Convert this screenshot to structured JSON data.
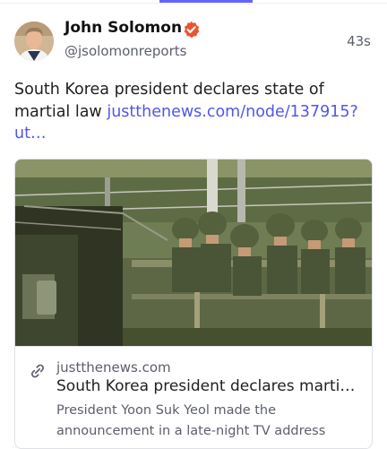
{
  "post": {
    "author_name": "John Solomon",
    "author_handle": "@jsolomonreports",
    "timestamp": "43s",
    "text": "South Korea president declares state of martial law",
    "link_text": "justthenews.com/node/137915?ut…",
    "verified_icon": "verified-badge-icon",
    "verified_color": "#e9552f"
  },
  "card": {
    "image_alt": "Soldiers in helmets riding in a military truck",
    "domain": "justthenews.com",
    "title": "South Korea president declares marti…",
    "description": "President Yoon Suk Yeol made the announcement in a late-night TV address",
    "link_icon": "link-icon"
  },
  "colors": {
    "accent": "#6364ff",
    "link": "#5257e8",
    "muted": "#5c5f6b"
  }
}
